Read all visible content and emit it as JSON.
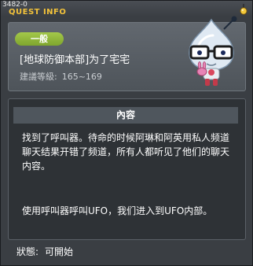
{
  "window": {
    "quest_id": "3482-0",
    "title": "QUEST INFO"
  },
  "header": {
    "badge": "一般",
    "quest_name": "[地球防御本部]为了宅宅",
    "level_label": "建議等級:",
    "level_value": "165~169"
  },
  "content": {
    "title": "內容",
    "paragraph1": "找到了呼叫器。待命的时候阿琳和阿英用私人频道聊天结果开错了频道，所有人都听见了他们的聊天内容。",
    "paragraph2": "使用呼叫器呼叫UFO，我们进入到UFO内部。"
  },
  "footer": {
    "status_label": "狀態:",
    "status_value": "可開始"
  },
  "colors": {
    "title_accent": "#f2c23a",
    "badge_green": "#8fb53a"
  }
}
